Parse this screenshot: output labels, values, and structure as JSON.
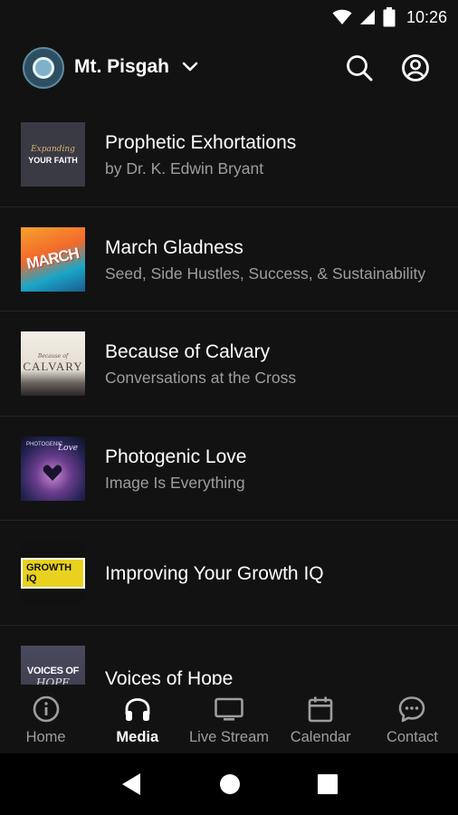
{
  "status_bar": {
    "time": "10:26"
  },
  "header": {
    "church_name": "Mt. Pisgah"
  },
  "media_items": [
    {
      "title": "Prophetic Exhortations",
      "subtitle": "by Dr. K. Edwin Bryant",
      "thumb": {
        "line1": "Expanding",
        "line2": "YOUR FAITH"
      }
    },
    {
      "title": "March Gladness",
      "subtitle": "Seed, Side Hustles, Success, & Sustainability",
      "thumb": {
        "line1": "MARCH"
      }
    },
    {
      "title": "Because of Calvary",
      "subtitle": "Conversations at the Cross",
      "thumb": {
        "line1": "Because of",
        "line2": "CALVARY"
      }
    },
    {
      "title": "Photogenic Love",
      "subtitle": "Image Is Everything",
      "thumb": {
        "line1": "PHOTOGENIC",
        "line2": "Love"
      }
    },
    {
      "title": "Improving Your Growth IQ",
      "subtitle": "",
      "thumb": {
        "line1": "GROWTH IQ"
      }
    },
    {
      "title": "Voices of Hope",
      "subtitle": "",
      "thumb": {
        "line1": "VOICES OF",
        "line2": "HOPE"
      }
    }
  ],
  "bottom_nav": {
    "items": [
      {
        "label": "Home",
        "icon": "info-circle-icon"
      },
      {
        "label": "Media",
        "icon": "headphones-icon"
      },
      {
        "label": "Live Stream",
        "icon": "monitor-icon"
      },
      {
        "label": "Calendar",
        "icon": "calendar-icon"
      },
      {
        "label": "Contact",
        "icon": "chat-bubble-icon"
      }
    ],
    "active": "Media"
  },
  "colors": {
    "background": "#121212",
    "text_primary": "#ffffff",
    "text_secondary": "#9e9e9e"
  }
}
